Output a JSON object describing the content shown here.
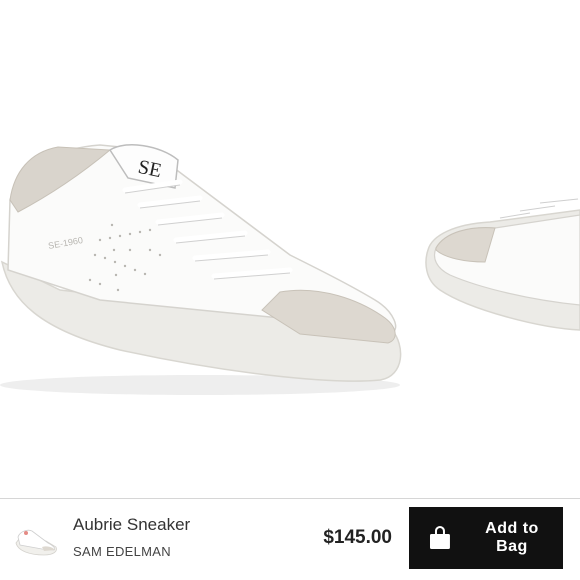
{
  "product": {
    "name": "Aubrie Sneaker",
    "brand": "SAM EDELMAN",
    "price": "$145.00",
    "image_tongue_text": "SE",
    "image_side_text": "SE-1960"
  },
  "cart": {
    "add_label": "Add to Bag",
    "icon": "shopping-bag-icon"
  },
  "colors": {
    "button_bg": "#111111",
    "button_text": "#ffffff",
    "suede": "#d9d4cc"
  }
}
